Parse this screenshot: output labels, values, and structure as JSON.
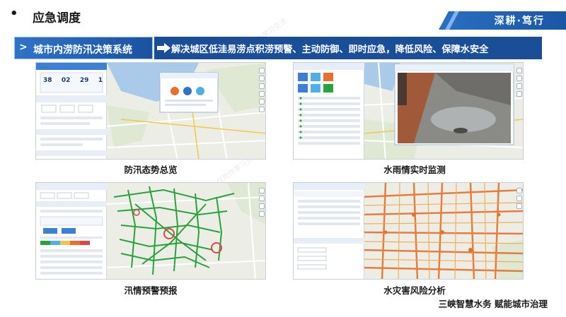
{
  "header": {
    "bullet": "•",
    "section_title": "应急调度",
    "slogan": "深耕·笃行"
  },
  "banner": {
    "system_name": "城市内涝防汛决策系统",
    "description": "解决城区低洼易涝点积涝预警、主动防御、即时应急，降低风险、保障水安全"
  },
  "screenshots": [
    {
      "caption": "防汛态势总览",
      "panel": {
        "counter": [
          "38",
          "02",
          "29",
          "1"
        ]
      }
    },
    {
      "caption": "水雨情实时监测"
    },
    {
      "caption": "汛情预警预报"
    },
    {
      "caption": "水灾害风险分析"
    }
  ],
  "footer": {
    "company": "三峡智慧水务 赋能城市治理"
  },
  "colors": {
    "brand_blue": "#1a4e97",
    "accent_blue": "#2e73c9",
    "warning_orange": "#e8702a",
    "route_green": "#27a33b"
  }
}
